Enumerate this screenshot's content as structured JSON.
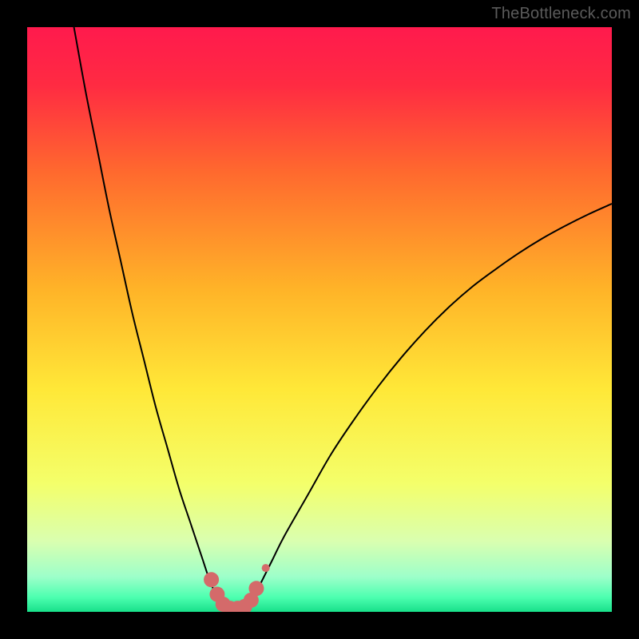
{
  "watermark": "TheBottleneck.com",
  "colors": {
    "frame": "#000000",
    "curve": "#000000",
    "marker_fill": "#d46a6a",
    "marker_stroke": "#d46a6a",
    "gradient_stops": [
      {
        "offset": 0.0,
        "color": "#ff1a4d"
      },
      {
        "offset": 0.1,
        "color": "#ff2b42"
      },
      {
        "offset": 0.25,
        "color": "#ff6a2e"
      },
      {
        "offset": 0.45,
        "color": "#ffb428"
      },
      {
        "offset": 0.62,
        "color": "#ffe838"
      },
      {
        "offset": 0.78,
        "color": "#f4ff6a"
      },
      {
        "offset": 0.88,
        "color": "#d9ffb0"
      },
      {
        "offset": 0.94,
        "color": "#9dffca"
      },
      {
        "offset": 0.975,
        "color": "#4dffb0"
      },
      {
        "offset": 1.0,
        "color": "#18e08a"
      }
    ]
  },
  "chart_data": {
    "type": "line",
    "title": "",
    "xlabel": "",
    "ylabel": "",
    "xlim": [
      0,
      100
    ],
    "ylim": [
      0,
      100
    ],
    "grid": false,
    "legend": false,
    "series": [
      {
        "name": "left-branch",
        "x": [
          8,
          10,
          12,
          14,
          16,
          18,
          20,
          22,
          24,
          26,
          28,
          30,
          31,
          32,
          33
        ],
        "y": [
          100,
          89,
          79,
          69,
          60,
          51,
          43,
          35,
          28,
          21,
          15,
          9,
          6,
          3.5,
          1.5
        ]
      },
      {
        "name": "right-branch",
        "x": [
          38,
          39,
          40,
          42,
          44,
          48,
          52,
          56,
          60,
          64,
          68,
          72,
          76,
          80,
          84,
          88,
          92,
          96,
          100
        ],
        "y": [
          1.5,
          3,
          5,
          9,
          13,
          20,
          27,
          33,
          38.5,
          43.5,
          48,
          52,
          55.5,
          58.5,
          61.3,
          63.8,
          66,
          68,
          69.8
        ]
      }
    ],
    "floor_band": {
      "x0": 33,
      "x1": 38,
      "y": 0.5
    },
    "markers": {
      "name": "highlight",
      "points_big": [
        {
          "x": 31.5,
          "y": 5.5
        },
        {
          "x": 32.5,
          "y": 3.0
        },
        {
          "x": 33.5,
          "y": 1.3
        },
        {
          "x": 34.7,
          "y": 0.6
        },
        {
          "x": 36.0,
          "y": 0.6
        },
        {
          "x": 37.2,
          "y": 0.9
        },
        {
          "x": 38.3,
          "y": 2.0
        },
        {
          "x": 39.2,
          "y": 4.0
        }
      ],
      "points_small": [
        {
          "x": 40.8,
          "y": 7.5
        }
      ]
    }
  }
}
